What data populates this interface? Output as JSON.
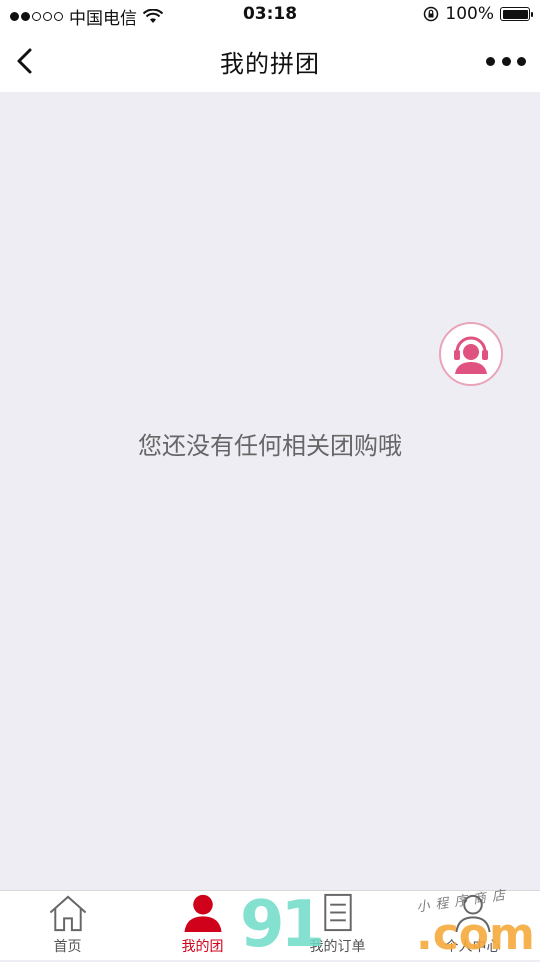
{
  "status_bar": {
    "carrier": "中国电信",
    "time": "03:18",
    "battery": "100%"
  },
  "nav": {
    "title": "我的拼团"
  },
  "content": {
    "empty_message": "您还没有任何相关团购哦"
  },
  "tabs": [
    {
      "label": "首页",
      "icon": "home-icon",
      "active": false
    },
    {
      "label": "我的团",
      "icon": "group-user-icon",
      "active": true
    },
    {
      "label": "我的订单",
      "icon": "order-list-icon",
      "active": false
    },
    {
      "label": "个人中心",
      "icon": "profile-icon",
      "active": false
    }
  ],
  "colors": {
    "active_tab": "#d0021b",
    "service_accent": "#e0527f",
    "background": "#efedf4"
  },
  "watermark": {
    "brand": "91",
    "domain": ".com",
    "handwriting": "小程序商店"
  }
}
